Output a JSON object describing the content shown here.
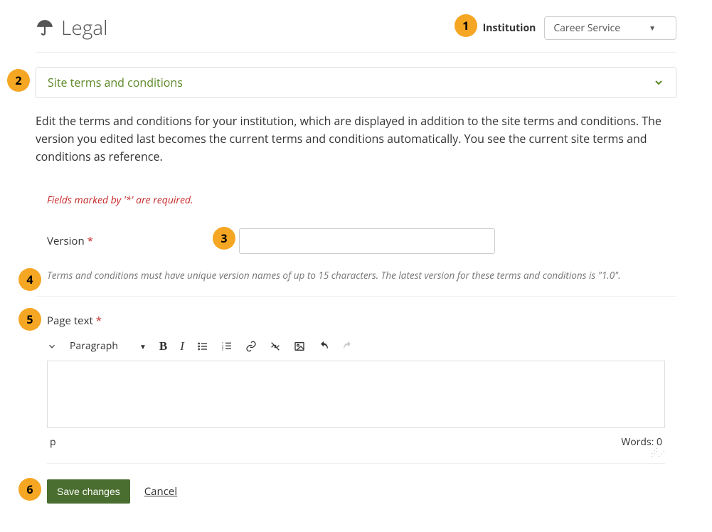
{
  "annotations": [
    "1",
    "2",
    "3",
    "4",
    "5",
    "6"
  ],
  "header": {
    "title": "Legal",
    "institution_label": "Institution",
    "institution_selected": "Career Service"
  },
  "accordion": {
    "title": "Site terms and conditions"
  },
  "description": "Edit the terms and conditions for your institution, which are displayed in addition to the site terms and conditions. The version you edited last becomes the current terms and conditions automatically. You see the current site terms and conditions as reference.",
  "required_note": "Fields marked by '*' are required.",
  "version": {
    "label": "Version",
    "value": "",
    "help": "Terms and conditions must have unique version names of up to 15 characters. The latest version for these terms and conditions is \"1.0\"."
  },
  "pagetext_label": "Page text",
  "editor": {
    "format_selected": "Paragraph",
    "path": "p",
    "words_label": "Words:",
    "words_count": "0"
  },
  "actions": {
    "save": "Save changes",
    "cancel": "Cancel"
  }
}
